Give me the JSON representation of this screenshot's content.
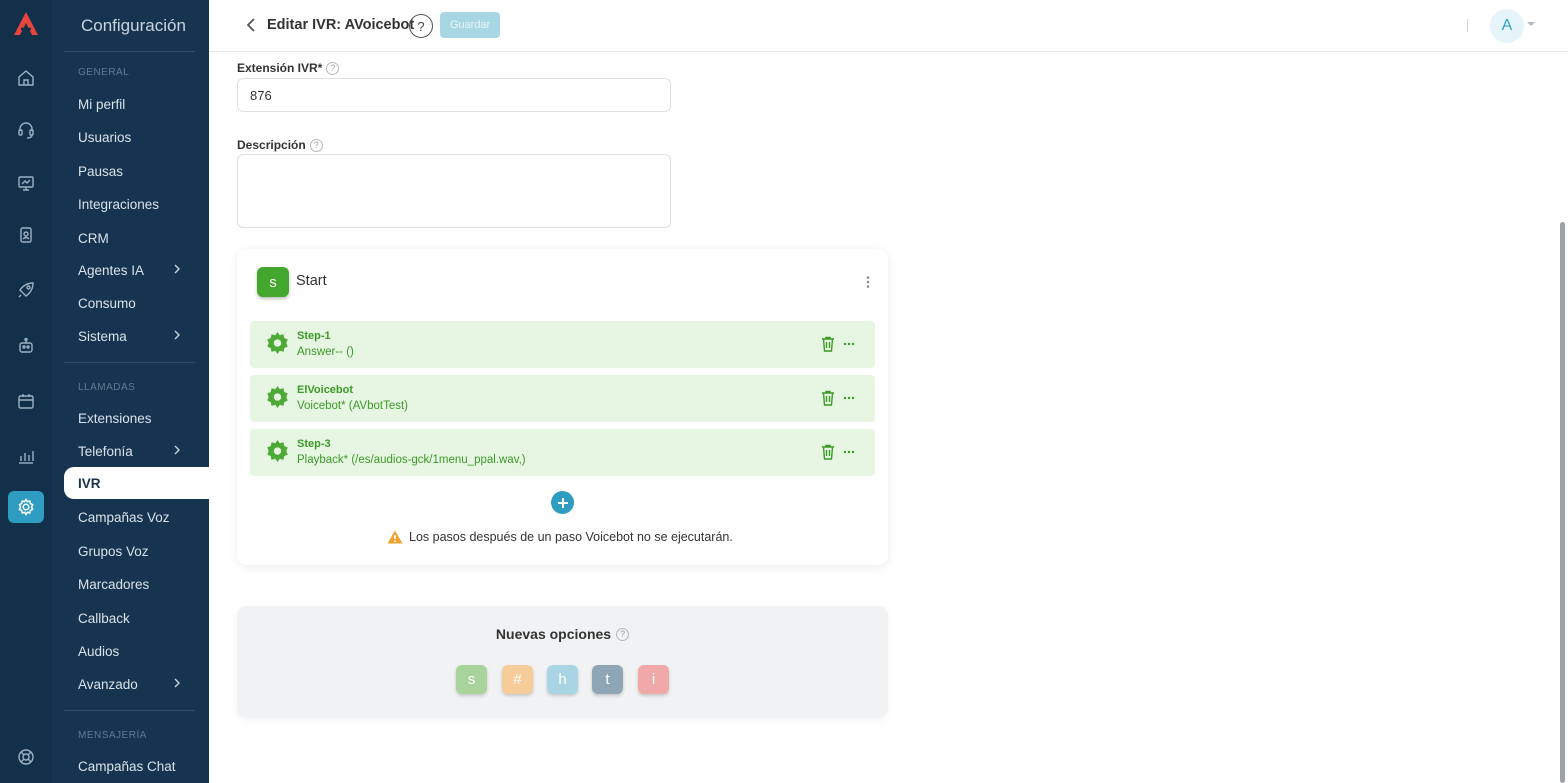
{
  "sidebar": {
    "title": "Configuración",
    "sections": {
      "general": "GENERAL",
      "llamadas": "LLAMADAS",
      "mensajeria": "MENSAJERÍA"
    },
    "items": [
      {
        "label": "Mi perfil"
      },
      {
        "label": "Usuarios"
      },
      {
        "label": "Pausas"
      },
      {
        "label": "Integraciones"
      },
      {
        "label": "CRM"
      },
      {
        "label": "Agentes IA"
      },
      {
        "label": "Consumo"
      },
      {
        "label": "Sistema"
      },
      {
        "label": "Extensiones"
      },
      {
        "label": "Telefonía"
      },
      {
        "label": "IVR"
      },
      {
        "label": "Campañas Voz"
      },
      {
        "label": "Grupos Voz"
      },
      {
        "label": "Marcadores"
      },
      {
        "label": "Callback"
      },
      {
        "label": "Audios"
      },
      {
        "label": "Avanzado"
      },
      {
        "label": "Campañas Chat"
      }
    ]
  },
  "header": {
    "title": "Editar IVR: AVoicebot",
    "help": "?",
    "save_label": "Guardar",
    "avatar_initial": "A"
  },
  "form": {
    "extension_label": "Extensión IVR*",
    "extension_value": "876",
    "description_label": "Descripción",
    "description_value": "",
    "help_glyph": "?"
  },
  "flow": {
    "badge": "s",
    "title": "Start",
    "steps": [
      {
        "name": "Step-1",
        "desc": "Answer-- ()"
      },
      {
        "name": "ElVoicebot",
        "desc": "Voicebot* (AVbotTest)"
      },
      {
        "name": "Step-3",
        "desc": "Playback* (/es/audios-gck/1menu_ppal.wav,)"
      }
    ],
    "warning": "Los pasos después de un paso Voicebot no se ejecutarán."
  },
  "options": {
    "title": "Nuevas opciones",
    "buttons": [
      {
        "label": "s",
        "color": "#a8d49b"
      },
      {
        "label": "#",
        "color": "#f5cc9a"
      },
      {
        "label": "h",
        "color": "#a9d4e3"
      },
      {
        "label": "t",
        "color": "#8fa6b6"
      },
      {
        "label": "i",
        "color": "#f1a8a8"
      }
    ]
  },
  "colors": {
    "sidebar": "#16344f",
    "rail": "#12304a",
    "accent": "#2f9cc1",
    "step_green": "#3c9a27",
    "step_bg": "#e6f6e3"
  }
}
